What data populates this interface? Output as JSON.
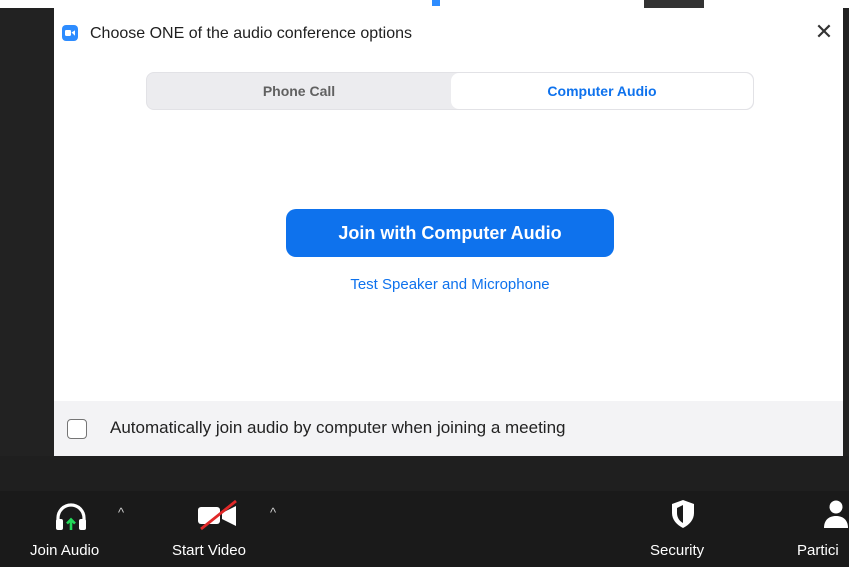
{
  "dialog": {
    "title": "Choose ONE of the audio conference options",
    "close_label": "✕",
    "tabs": [
      {
        "label": "Phone Call",
        "selected": false
      },
      {
        "label": "Computer Audio",
        "selected": true
      }
    ],
    "join_button": "Join with Computer Audio",
    "test_link": "Test Speaker and Microphone",
    "auto_join_label": "Automatically join audio by computer when joining a meeting",
    "auto_join_checked": false
  },
  "toolbar": {
    "join_audio": "Join Audio",
    "start_video": "Start Video",
    "security": "Security",
    "participants": "Partici"
  },
  "colors": {
    "accent": "#0e72ed",
    "toolbar_bg": "#1a1a1a",
    "audio_arrow": "#23d959",
    "video_slash": "#e02828"
  },
  "icons": {
    "app": "zoom-camera-icon",
    "close": "close-icon",
    "join_audio": "headphones-icon",
    "start_video": "video-off-icon",
    "security": "shield-icon",
    "participants": "person-icon"
  }
}
